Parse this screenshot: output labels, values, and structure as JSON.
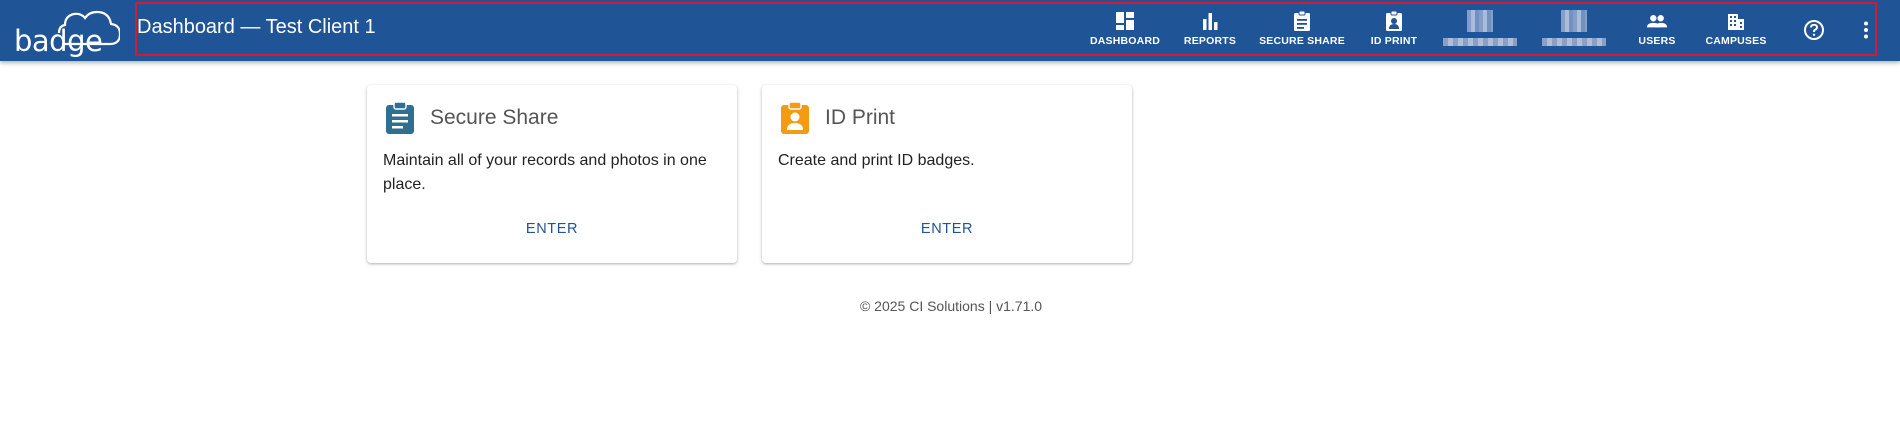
{
  "app": {
    "logo_text": "badge",
    "page_title": "Dashboard — Test Client 1"
  },
  "nav": [
    {
      "label": "DASHBOARD",
      "icon": "dashboard-icon"
    },
    {
      "label": "REPORTS",
      "icon": "bar-chart-icon"
    },
    {
      "label": "SECURE SHARE",
      "icon": "clipboard-icon"
    },
    {
      "label": "ID PRINT",
      "icon": "id-badge-icon"
    },
    {
      "label": "",
      "icon": "blurred-icon"
    },
    {
      "label": "",
      "icon": "blurred-icon"
    },
    {
      "label": "USERS",
      "icon": "people-icon"
    },
    {
      "label": "CAMPUSES",
      "icon": "building-icon"
    }
  ],
  "header_actions": {
    "help_icon": "help-circle-icon",
    "more_icon": "more-vertical-icon"
  },
  "cards": [
    {
      "title": "Secure Share",
      "description": "Maintain all of your records and photos in one place.",
      "action": "ENTER",
      "icon": "clipboard-icon",
      "icon_color": "#2f6f8f"
    },
    {
      "title": "ID Print",
      "description": "Create and print ID badges.",
      "action": "ENTER",
      "icon": "id-badge-icon",
      "icon_color": "#f39c12"
    }
  ],
  "footer": {
    "text": "© 2025 CI Solutions | v1.71.0"
  },
  "colors": {
    "header_bg": "#1f5497",
    "accent": "#1f5497",
    "highlight_outline": "#d31b2e"
  }
}
